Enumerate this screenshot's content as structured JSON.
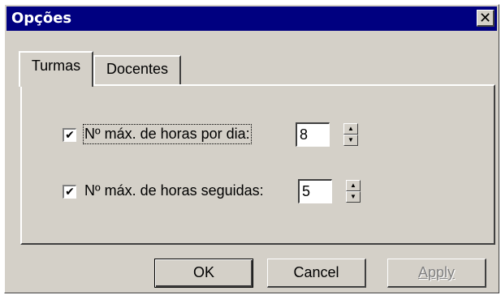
{
  "window": {
    "title": "Opções",
    "close_label": "✕"
  },
  "tabs": [
    {
      "label": "Turmas",
      "selected": true
    },
    {
      "label": "Docentes",
      "selected": false
    }
  ],
  "options": [
    {
      "label": "Nº máx. de horas por dia:",
      "checked": true,
      "value": "8"
    },
    {
      "label": "Nº máx. de horas seguidas:",
      "checked": true,
      "value": "5"
    }
  ],
  "buttons": {
    "ok": "OK",
    "cancel": "Cancel",
    "apply": "Apply"
  },
  "icons": {
    "checkmark": "✔",
    "spin_up": "▲",
    "spin_down": "▼"
  }
}
